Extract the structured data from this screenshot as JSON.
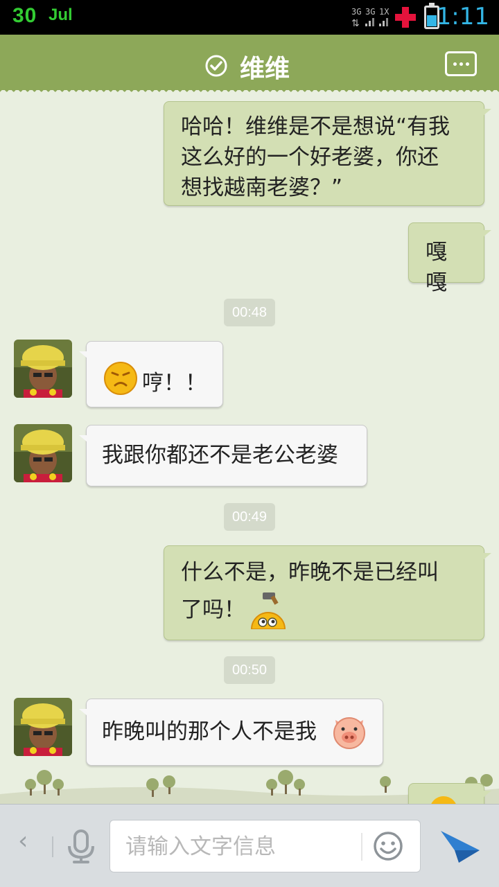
{
  "status_bar": {
    "date_day": "30",
    "date_month": "Jul",
    "time": "1:11",
    "network_label": "3G 3G 1X",
    "battery_level": 0.58,
    "accent_color": "#33cc33",
    "time_color": "#33b5e5"
  },
  "header": {
    "title": "维维",
    "verified_icon": "check-circle-icon",
    "menu_icon": "more-dots-icon",
    "background_color": "#8da859"
  },
  "messages": [
    {
      "side": "mine",
      "lines": [
        "哈哈！维维是不是想说“有我",
        "这么好的一个好老婆，你还",
        "想找越南老婆？”"
      ]
    },
    {
      "side": "mine",
      "text": "嘎嘎"
    },
    {
      "type": "timestamp",
      "text": "00:48"
    },
    {
      "side": "theirs",
      "emoji": "frown-face-icon",
      "text": "哼！！"
    },
    {
      "side": "theirs",
      "text": "我跟你都还不是老公老婆"
    },
    {
      "type": "timestamp",
      "text": "00:49"
    },
    {
      "side": "mine",
      "lines": [
        "什么不是，昨晚不是已经叫",
        "了吗！"
      ],
      "emoji": "hammer-face-icon"
    },
    {
      "type": "timestamp",
      "text": "00:50"
    },
    {
      "side": "theirs",
      "text": "昨晚叫的那个人不是我",
      "emoji": "pig-face-icon"
    }
  ],
  "input_bar": {
    "back_icon": "chevron-left-icon",
    "mic_icon": "microphone-icon",
    "placeholder": "请输入文字信息",
    "emoji_icon": "smiley-icon",
    "send_icon": "paper-plane-icon"
  },
  "colors": {
    "chat_background": "#e9efe0",
    "my_bubble": "#d3dfb4",
    "their_bubble": "#f7f7f7",
    "send_button": "#2f7fd0"
  }
}
